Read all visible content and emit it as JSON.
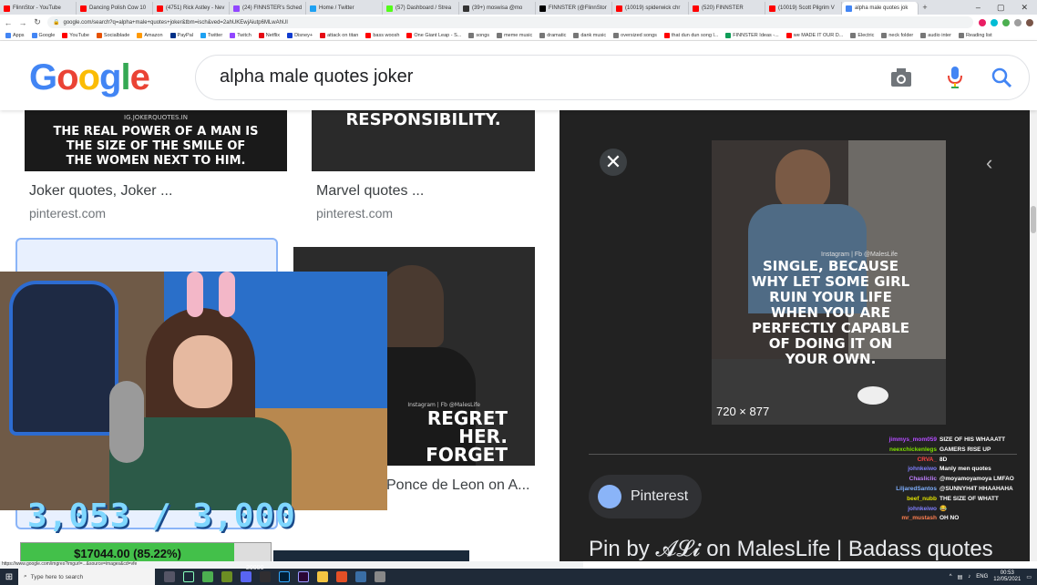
{
  "browser": {
    "tabs": [
      {
        "label": "FlinnStor - YouTube",
        "color": "#ff0000"
      },
      {
        "label": "Dancing Polish Cow 10",
        "color": "#ff0000"
      },
      {
        "label": "(4751) Rick Astley - Nev",
        "color": "#ff0000"
      },
      {
        "label": "(24) FINNSTER's Sched",
        "color": "#9146ff"
      },
      {
        "label": "Home / Twitter",
        "color": "#1da1f2"
      },
      {
        "label": "(57) Dashboard / Strea",
        "color": "#53fc18"
      },
      {
        "label": "(39+) moswisa @mo",
        "color": "#333333"
      },
      {
        "label": "FINNSTER (@FlinnStor",
        "color": "#000000"
      },
      {
        "label": "(10019) spiderwick chr",
        "color": "#ff0000"
      },
      {
        "label": "(520) FINNSTER",
        "color": "#ff0000"
      },
      {
        "label": "(10019) Scott Pilgrim V",
        "color": "#ff0000"
      },
      {
        "label": "alpha male quotes jok",
        "color": "#4285f4",
        "active": true
      }
    ],
    "url": "google.com/search?q=alpha+male+quotes+joker&tbm=isch&ved=2ahUKEwjAiutp6MLwAhUI",
    "bookmarks": [
      {
        "label": "Apps",
        "color": "#4285f4"
      },
      {
        "label": "Google",
        "color": "#4285f4"
      },
      {
        "label": "YouTube",
        "color": "#ff0000"
      },
      {
        "label": "Socialblade",
        "color": "#e65100"
      },
      {
        "label": "Amazon",
        "color": "#ff9900"
      },
      {
        "label": "PayPal",
        "color": "#003087"
      },
      {
        "label": "Twitter",
        "color": "#1da1f2"
      },
      {
        "label": "Twitch",
        "color": "#9146ff"
      },
      {
        "label": "Netflix",
        "color": "#e50914"
      },
      {
        "label": "Disney+",
        "color": "#113ccf"
      },
      {
        "label": "attack on titan",
        "color": "#e50914"
      },
      {
        "label": "bass woosh",
        "color": "#ff0000"
      },
      {
        "label": "One Giant Leap - S...",
        "color": "#ff0000"
      },
      {
        "label": "songs",
        "color": "#777777"
      },
      {
        "label": "meme music",
        "color": "#777777"
      },
      {
        "label": "dramatic",
        "color": "#777777"
      },
      {
        "label": "dank music",
        "color": "#777777"
      },
      {
        "label": "oversized songs",
        "color": "#777777"
      },
      {
        "label": "that dun dun song l...",
        "color": "#ff0000"
      },
      {
        "label": "FINNSTER Ideas -...",
        "color": "#0f9d58"
      },
      {
        "label": "we MADE IT OUR D...",
        "color": "#ff0000"
      },
      {
        "label": "Electric",
        "color": "#777777"
      },
      {
        "label": "neck folder",
        "color": "#777777"
      },
      {
        "label": "audio inter",
        "color": "#777777"
      },
      {
        "label": "Reading list",
        "color": "#777777"
      }
    ]
  },
  "google": {
    "logo": "Google",
    "query": "alpha male quotes joker"
  },
  "results": [
    {
      "title": "Joker quotes, Joker ...",
      "source": "pinterest.com",
      "caption": "THE REAL POWER OF A MAN IS THE SIZE OF THE SMILE OF THE WOMEN NEXT TO HIM.",
      "watermark": "IG.JOKERQUOTES.IN"
    },
    {
      "title": "Marvel quotes ...",
      "source": "pinterest.com",
      "caption": "RESPONSIBILITY."
    },
    {
      "title": "Ponce de Leon on A...",
      "source": "",
      "caption": "REGRET HER. FORGET HER.",
      "watermark": "Instagram | Fb @MalesLife"
    }
  ],
  "preview": {
    "image_caption": "SINGLE, BECAUSE WHY LET SOME GIRL RUIN YOUR LIFE WHEN YOU ARE PERFECTLY CAPABLE OF DOING IT ON YOUR OWN.",
    "image_watermark": "Instagram | Fb @MalesLife",
    "dimensions": "720 × 877",
    "site": "Pinterest",
    "title": "Pin by 𝓐𝓛𝓲 on MalesLife | Badass quotes"
  },
  "stream": {
    "counter": "3,053 / 3,000",
    "donation": "$17044.00 (85.22%)",
    "donation_pct": 85.22,
    "goal_fragment": "20000",
    "chat": [
      {
        "user": "jimmys_mom059",
        "msg": "SIZE OF HIS WHAAATT",
        "color": "#b44cff"
      },
      {
        "user": "neexchickenlegs",
        "msg": "GAMERS RISE UP",
        "color": "#7ee000"
      },
      {
        "user": "CRVA_",
        "msg": "8D",
        "color": "#ff4444"
      },
      {
        "user": "johnkeiwo",
        "msg": "Manly men quotes",
        "color": "#7f7fff"
      },
      {
        "user": "Chasliclic",
        "msg": "@moyamoyamoya LMFAO",
        "color": "#c07fff"
      },
      {
        "user": "LiljaredSantos",
        "msg": "@SUNNYH4T HHAAHAHA",
        "color": "#7fb0ff"
      },
      {
        "user": "beef_nubb",
        "msg": "THE SIZE OF WHATT",
        "color": "#e0e000"
      },
      {
        "user": "johnkeiwo",
        "msg": "😂",
        "color": "#7f7fff"
      },
      {
        "user": "mr_mustash",
        "msg": "OH NO",
        "color": "#ff7f50"
      }
    ]
  },
  "taskbar": {
    "search_placeholder": "Type here to search",
    "lang": "ENG",
    "time": "00:53",
    "date": "12/05/2021"
  }
}
